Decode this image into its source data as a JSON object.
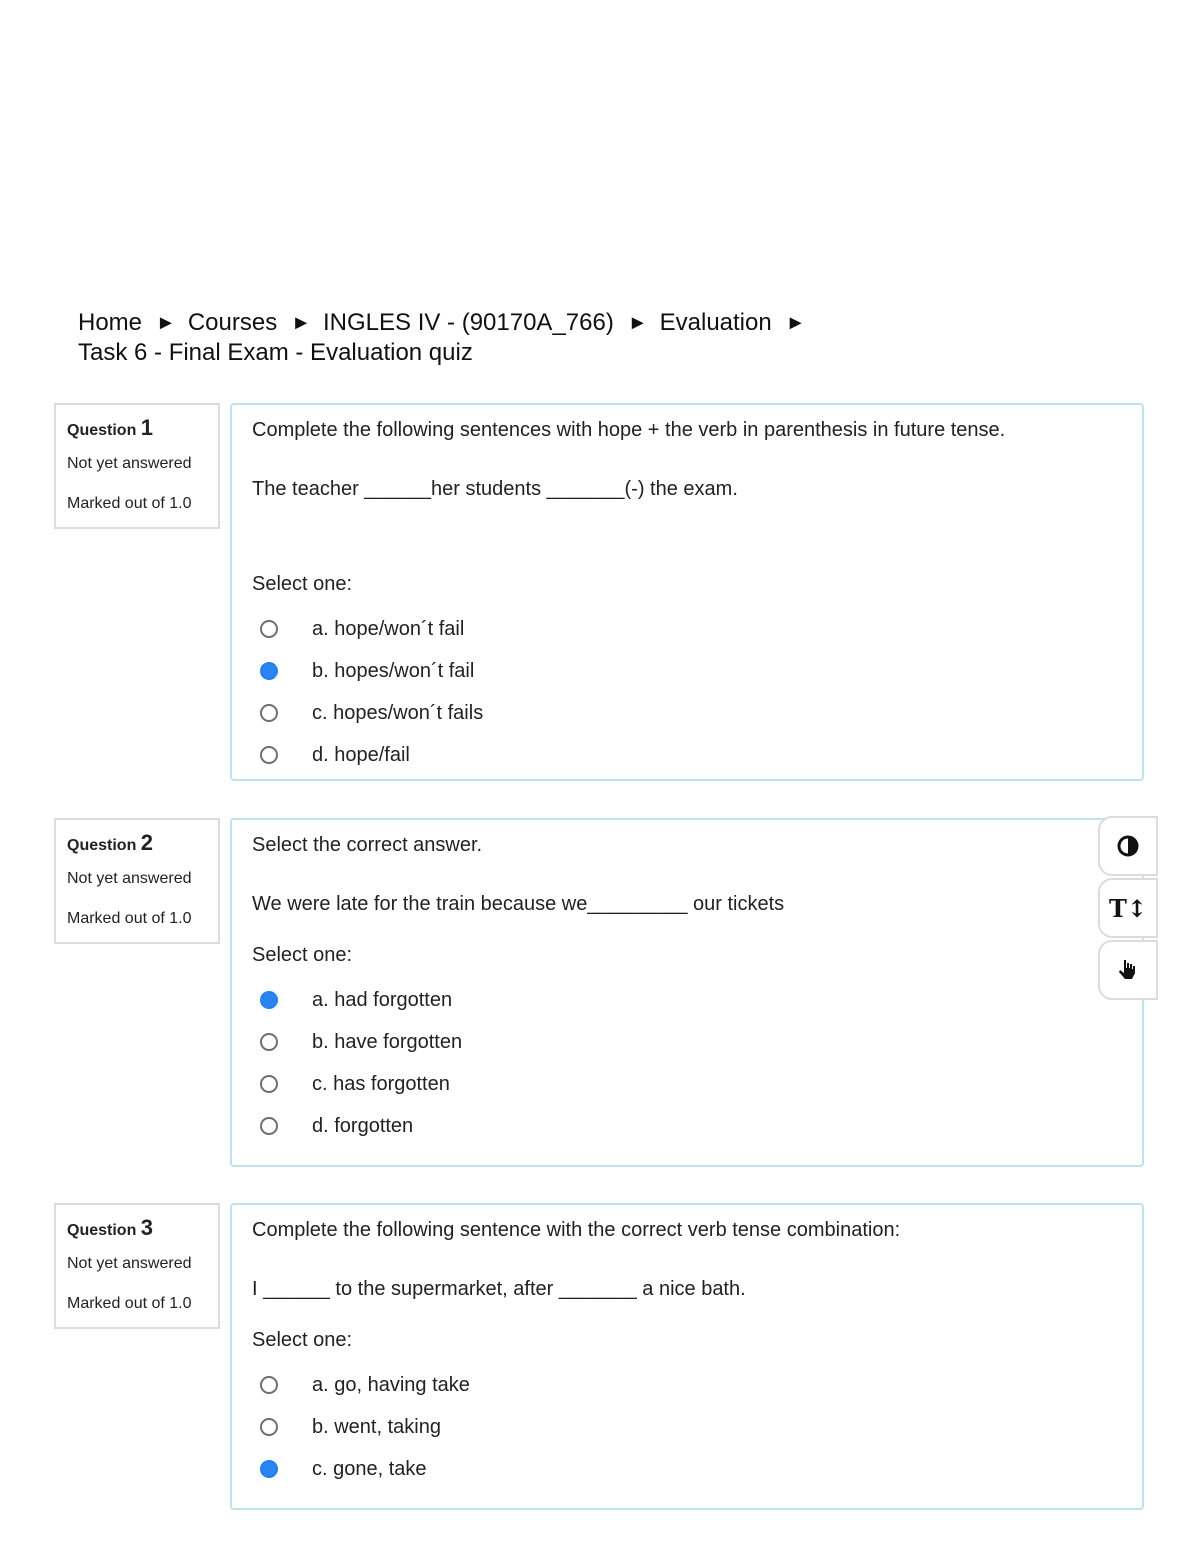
{
  "breadcrumb": {
    "items": [
      "Home",
      "Courses",
      "INGLES IV - (90170A_766)",
      "Evaluation"
    ],
    "current": "Task 6 - Final Exam - Evaluation quiz",
    "separator": "►"
  },
  "questions": [
    {
      "label": "Question",
      "number": "1",
      "state": "Not yet answered",
      "marks": "Marked out of 1.0",
      "text": "Complete the following sentences with hope + the verb in parenthesis in future tense.",
      "prompt": "The teacher ______her students _______(-) the exam.",
      "select_label": "Select one:",
      "answers": [
        {
          "label": "a. hope/won´t fail",
          "checked": false
        },
        {
          "label": "b. hopes/won´t fail",
          "checked": true
        },
        {
          "label": "c. hopes/won´t fails",
          "checked": false
        },
        {
          "label": "d. hope/fail",
          "checked": false
        }
      ]
    },
    {
      "label": "Question",
      "number": "2",
      "state": "Not yet answered",
      "marks": "Marked out of 1.0",
      "text": "Select the correct answer.",
      "prompt": "We were late for the train because we_________ our tickets",
      "select_label": "Select one:",
      "answers": [
        {
          "label": "a. had forgotten",
          "checked": true
        },
        {
          "label": "b. have forgotten",
          "checked": false
        },
        {
          "label": "c. has forgotten",
          "checked": false
        },
        {
          "label": "d. forgotten",
          "checked": false
        }
      ]
    },
    {
      "label": "Question",
      "number": "3",
      "state": "Not yet answered",
      "marks": "Marked out of 1.0",
      "text": "Complete the following sentence with the correct verb tense combination:",
      "prompt": "I ______ to the supermarket, after _______ a nice bath.",
      "select_label": "Select one:",
      "answers": [
        {
          "label": "a. go, having take",
          "checked": false
        },
        {
          "label": "b. went, taking",
          "checked": false
        },
        {
          "label": "c. gone, take",
          "checked": true
        }
      ]
    }
  ],
  "tools": {
    "contrast_icon": "contrast-icon",
    "text_size_glyph": "T↕",
    "text_size_icon": "text-size-icon",
    "hand_icon": "hand-pointer-icon"
  },
  "colors": {
    "accent": "#2b85f0",
    "question_border": "#bfe3ea",
    "info_border": "#dcdcdc"
  }
}
